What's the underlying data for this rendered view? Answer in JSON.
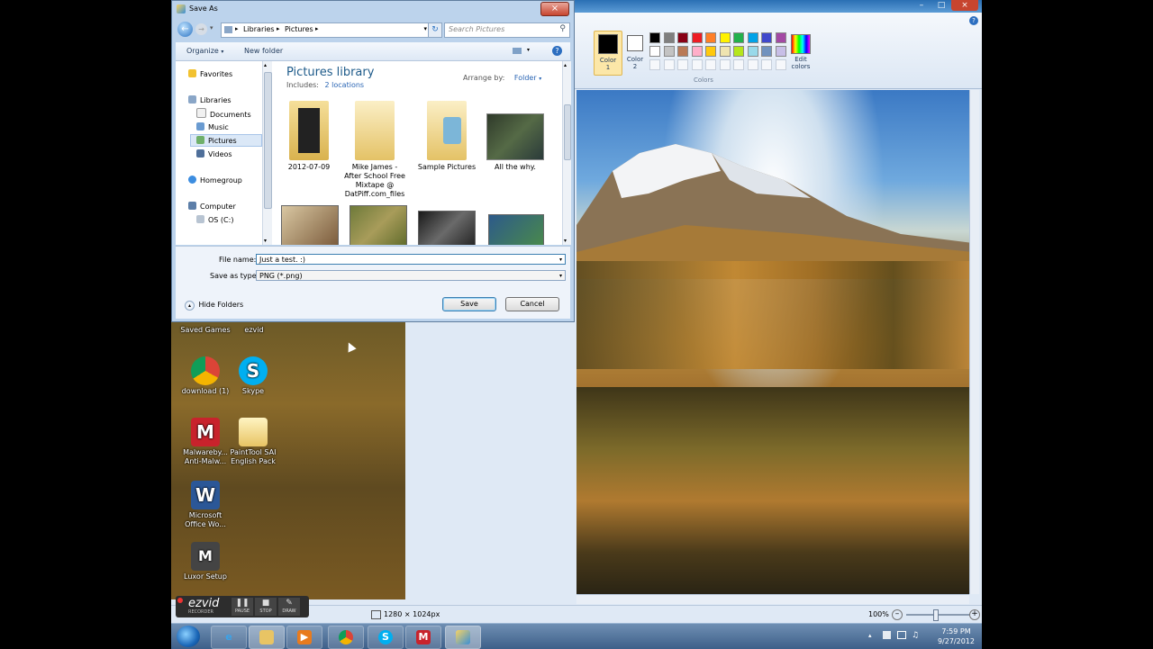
{
  "dialog": {
    "title": "Save As",
    "address": {
      "crumbs": [
        "Libraries",
        "Pictures"
      ]
    },
    "search_placeholder": "Search Pictures",
    "toolbar": {
      "organize": "Organize",
      "new_folder": "New folder"
    },
    "nav": {
      "favorites": "Favorites",
      "libraries": "Libraries",
      "documents": "Documents",
      "music": "Music",
      "pictures": "Pictures",
      "videos": "Videos",
      "homegroup": "Homegroup",
      "computer": "Computer",
      "os_c": "OS (C:)"
    },
    "library": {
      "title": "Pictures library",
      "includes_label": "Includes:",
      "includes_link": "2 locations",
      "arrange_label": "Arrange by:",
      "arrange_value": "Folder"
    },
    "items": [
      {
        "label": "2012-07-09"
      },
      {
        "label": "Mike James - After School Free Mixtape @ DatPiff.com_files"
      },
      {
        "label": "Sample Pictures"
      },
      {
        "label": "All the why."
      }
    ],
    "file_name_label": "File name:",
    "file_name_value": "Just a test. :)",
    "save_type_label": "Save as type:",
    "save_type_value": "PNG (*.png)",
    "hide_folders": "Hide Folders",
    "save_button": "Save",
    "cancel_button": "Cancel"
  },
  "paint": {
    "color1_label": "Color\n1",
    "color2_label": "Color\n2",
    "edit_colors": "Edit colors",
    "colors_group": "Colors",
    "status_size": "1280 × 1024px",
    "zoom": "100%",
    "palette": [
      "#000000",
      "#7f7f7f",
      "#880015",
      "#ed1c24",
      "#ff7f27",
      "#fff200",
      "#22b14c",
      "#00a2e8",
      "#3f48cc",
      "#a349a4",
      "#ffffff",
      "#c3c3c3",
      "#b97a57",
      "#ffaec9",
      "#ffc90e",
      "#efe4b0",
      "#b5e61d",
      "#99d9ea",
      "#7092be",
      "#c8bfe7"
    ]
  },
  "desktop": {
    "icons": [
      {
        "label": "Saved Games"
      },
      {
        "label": "ezvid"
      },
      {
        "label": "download (1)"
      },
      {
        "label": "Skype"
      },
      {
        "label": "Malwareby... Anti-Malw..."
      },
      {
        "label": "PaintTool SAI English Pack"
      },
      {
        "label": "Microsoft Office Wo..."
      },
      {
        "label": "Luxor Setup"
      }
    ]
  },
  "ezvid": {
    "brand": "ezvid",
    "sub": "RECORDER",
    "pause": "PAUSE",
    "stop": "STOP",
    "draw": "DRAW"
  },
  "taskbar": {
    "time": "7:59 PM",
    "date": "9/27/2012"
  }
}
